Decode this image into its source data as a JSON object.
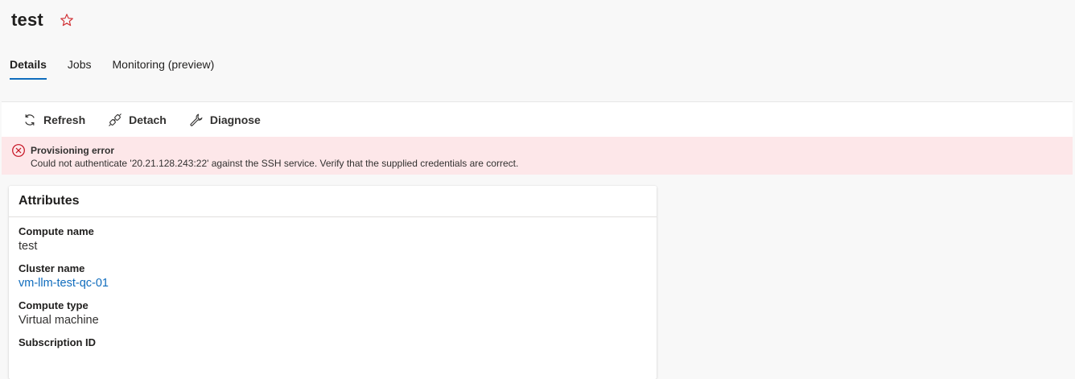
{
  "page": {
    "title": "test"
  },
  "tabs": [
    {
      "label": "Details",
      "active": true
    },
    {
      "label": "Jobs",
      "active": false
    },
    {
      "label": "Monitoring (preview)",
      "active": false
    }
  ],
  "toolbar": {
    "refresh_label": "Refresh",
    "detach_label": "Detach",
    "diagnose_label": "Diagnose"
  },
  "banner": {
    "title": "Provisioning error",
    "message": "Could not authenticate '20.21.128.243:22' against the SSH service. Verify that the supplied credentials are correct."
  },
  "attributes": {
    "title": "Attributes",
    "items": [
      {
        "label": "Compute name",
        "value": "test"
      },
      {
        "label": "Cluster name",
        "value": "vm-llm-test-qc-01"
      },
      {
        "label": "Compute type",
        "value": "Virtual machine"
      },
      {
        "label": "Subscription ID",
        "value": ""
      }
    ]
  },
  "colors": {
    "accent": "#0f6cbd",
    "error_bg": "#fde7e9",
    "error_icon": "#c50f1f",
    "star": "#d13438"
  },
  "icons": {
    "favorite": "star-icon",
    "refresh": "refresh-icon",
    "detach": "detach-icon",
    "diagnose": "wrench-icon",
    "error": "error-circle-icon"
  }
}
